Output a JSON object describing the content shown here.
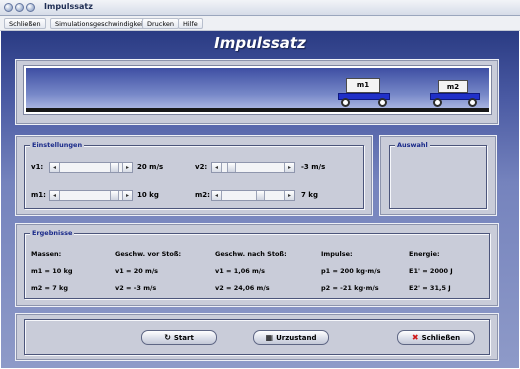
{
  "window": {
    "title": "Impulssatz"
  },
  "menu": {
    "items": [
      {
        "label": "Schließen"
      },
      {
        "label": "Simulationsgeschwindigkeit"
      },
      {
        "label": "Drucken"
      },
      {
        "label": "Hilfe"
      }
    ]
  },
  "heading": "Impulssatz",
  "simulation": {
    "cart1": {
      "label": "m1",
      "color": "#2030c8"
    },
    "cart2": {
      "label": "m2",
      "color": "#2030c8"
    }
  },
  "settings": {
    "legend": "Einstellungen",
    "v1": {
      "label": "v1:",
      "value": "20 m/s",
      "level": 0.95
    },
    "v2": {
      "label": "v2:",
      "value": "-3 m/s",
      "level": 0.1
    },
    "m1": {
      "label": "m1:",
      "value": "10 kg",
      "level": 0.95
    },
    "m2": {
      "label": "m2:",
      "value": "7 kg",
      "level": 0.65
    }
  },
  "selection": {
    "legend": "Auswahl"
  },
  "results": {
    "legend": "Ergebnisse",
    "headers": [
      "Massen:",
      "Geschw. vor Stoß:",
      "Geschw. nach Stoß:",
      "Impulse:",
      "Energie:"
    ],
    "rows": [
      [
        "m1 = 10 kg",
        "v1 = 20 m/s",
        "v1 = 1,06 m/s",
        "p1 = 200 kg·m/s",
        "E1' = 2000 J"
      ],
      [
        "m2 = 7 kg",
        "v2 = -3 m/s",
        "v2 = 24,06 m/s",
        "p2 = -21 kg·m/s",
        "E2' = 31,5 J"
      ]
    ]
  },
  "buttons": {
    "start": {
      "label": "Start",
      "icon": "restart-icon"
    },
    "reset": {
      "label": "Urzustand",
      "icon": "grid-icon"
    },
    "close": {
      "label": "Schließen",
      "icon": "close-x-icon",
      "icon_color": "#d01818"
    }
  }
}
